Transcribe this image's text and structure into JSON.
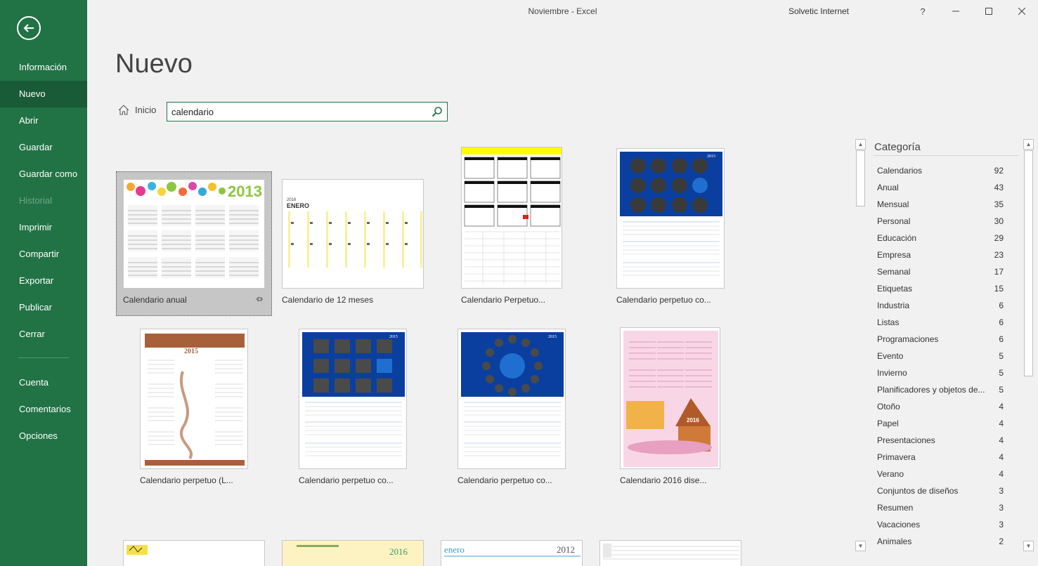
{
  "window": {
    "title": "Noviembre  -  Excel",
    "account": "Solvetic Internet",
    "help": "?"
  },
  "sidebar": {
    "items": [
      {
        "label": "Información"
      },
      {
        "label": "Nuevo"
      },
      {
        "label": "Abrir"
      },
      {
        "label": "Guardar"
      },
      {
        "label": "Guardar como"
      },
      {
        "label": "Historial"
      },
      {
        "label": "Imprimir"
      },
      {
        "label": "Compartir"
      },
      {
        "label": "Exportar"
      },
      {
        "label": "Publicar"
      },
      {
        "label": "Cerrar"
      }
    ],
    "bottom": [
      {
        "label": "Cuenta"
      },
      {
        "label": "Comentarios"
      },
      {
        "label": "Opciones"
      }
    ]
  },
  "page": {
    "title": "Nuevo",
    "home": "Inicio"
  },
  "search": {
    "value": "calendario"
  },
  "templates": [
    {
      "label": "Calendario anual",
      "year": "2013"
    },
    {
      "label": "Calendario de 12 meses",
      "year": "2016",
      "month": "ENERO"
    },
    {
      "label": "Calendario Perpetuo..."
    },
    {
      "label": "Calendario perpetuo co...",
      "year": "2015"
    },
    {
      "label": "Calendario perpetuo (L...",
      "year": "2015"
    },
    {
      "label": "Calendario perpetuo co...",
      "year": "2015"
    },
    {
      "label": "Calendario perpetuo co...",
      "year": "2015"
    },
    {
      "label": "Calendario 2016 dise...",
      "year": "2016"
    },
    {
      "label": ""
    },
    {
      "label": "",
      "year": "2016"
    },
    {
      "label": "",
      "month": "enero",
      "year": "2012"
    },
    {
      "label": ""
    }
  ],
  "categories": {
    "title": "Categoría",
    "items": [
      {
        "name": "Calendarios",
        "count": "92"
      },
      {
        "name": "Anual",
        "count": "43"
      },
      {
        "name": "Mensual",
        "count": "35"
      },
      {
        "name": "Personal",
        "count": "30"
      },
      {
        "name": "Educación",
        "count": "29"
      },
      {
        "name": "Empresa",
        "count": "23"
      },
      {
        "name": "Semanal",
        "count": "17"
      },
      {
        "name": "Etiquetas",
        "count": "15"
      },
      {
        "name": "Industria",
        "count": "6"
      },
      {
        "name": "Listas",
        "count": "6"
      },
      {
        "name": "Programaciones",
        "count": "6"
      },
      {
        "name": "Evento",
        "count": "5"
      },
      {
        "name": "Invierno",
        "count": "5"
      },
      {
        "name": "Planificadores y objetos de...",
        "count": "5"
      },
      {
        "name": "Otoño",
        "count": "4"
      },
      {
        "name": "Papel",
        "count": "4"
      },
      {
        "name": "Presentaciones",
        "count": "4"
      },
      {
        "name": "Primavera",
        "count": "4"
      },
      {
        "name": "Verano",
        "count": "4"
      },
      {
        "name": "Conjuntos de diseños",
        "count": "3"
      },
      {
        "name": "Resumen",
        "count": "3"
      },
      {
        "name": "Vacaciones",
        "count": "3"
      },
      {
        "name": "Animales",
        "count": "2"
      }
    ]
  },
  "colors": {
    "brand": "#217346",
    "active": "#195b37",
    "zodiac_blue": "#0a3fa0",
    "highlight_yellow": "#ffff00"
  }
}
